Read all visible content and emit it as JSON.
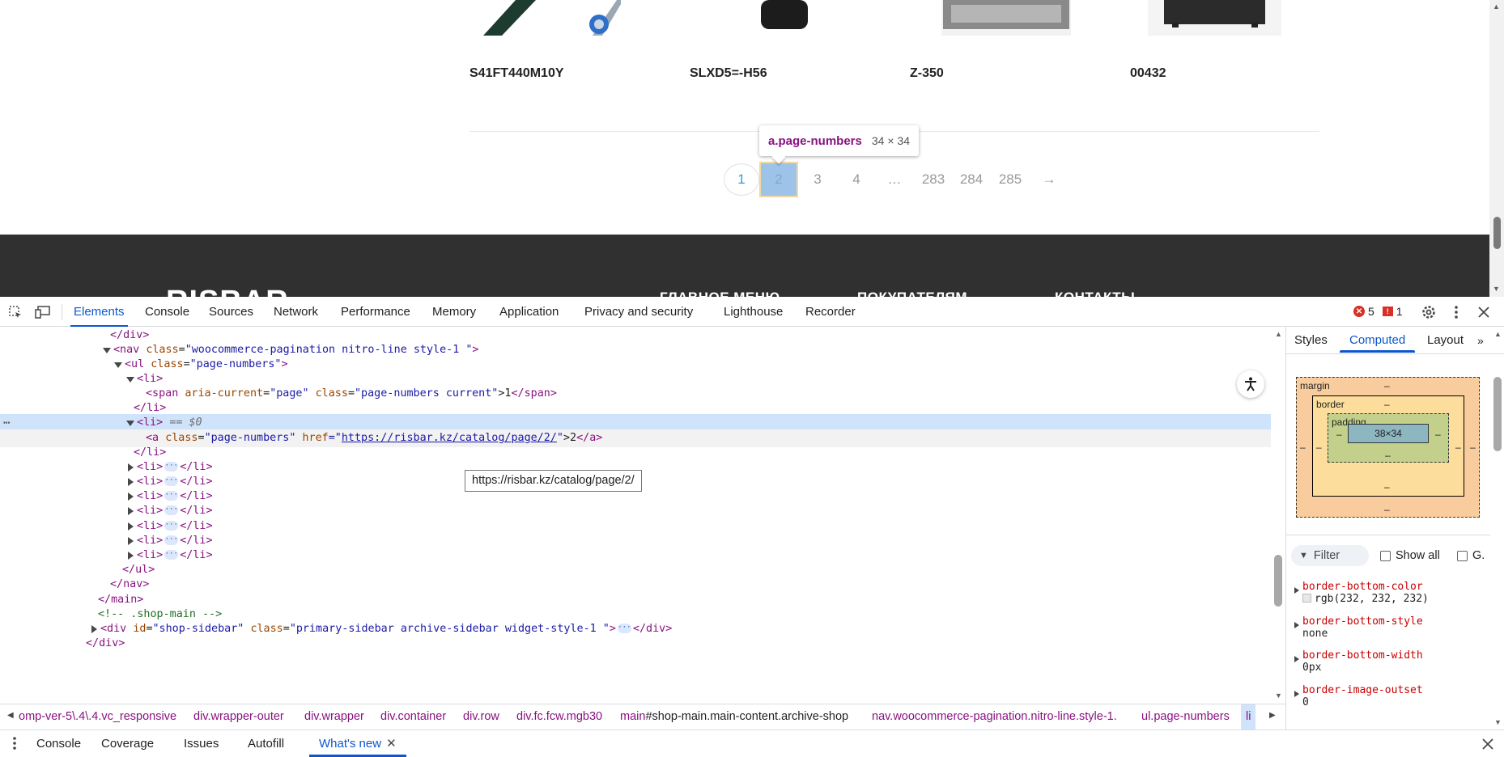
{
  "page": {
    "products": [
      {
        "sku": "S41FT440M10Y"
      },
      {
        "sku": "SLXD5=-H56"
      },
      {
        "sku": "Z-350"
      },
      {
        "sku": "00432"
      }
    ],
    "pagination": [
      "1",
      "2",
      "3",
      "4",
      "…",
      "283",
      "284",
      "285",
      "→"
    ],
    "tooltip": {
      "selector": "a.page-numbers",
      "size": "34 × 34"
    },
    "footer": {
      "logo": "RISBAR",
      "headings": [
        "ГЛАВНОЕ МЕНЮ",
        "ПОКУПАТЕЛЯМ",
        "КОНТАКТЫ"
      ]
    }
  },
  "devtools": {
    "tabs": [
      "Elements",
      "Console",
      "Sources",
      "Network",
      "Performance",
      "Memory",
      "Application",
      "Privacy and security",
      "Lighthouse",
      "Recorder"
    ],
    "active_tab": "Elements",
    "error_count": "5",
    "issue_count": "1",
    "dom": {
      "l0": {
        "close": "</div>"
      },
      "l1": {
        "open": "<nav",
        "attr": "class",
        "val": "\"woocommerce-pagination nitro-line style-1 \"",
        "end": ">"
      },
      "l2": {
        "open": "<ul",
        "attr": "class",
        "val": "\"page-numbers\"",
        "end": ">"
      },
      "l3": {
        "tag": "<li>"
      },
      "l4": {
        "open": "<span",
        "attr1": "aria-current",
        "val1": "\"page\"",
        "attr2": "class",
        "val2": "\"page-numbers current\"",
        "text": ">1",
        "close": "</span>"
      },
      "l5": {
        "close": "</li>"
      },
      "l6": {
        "tag": "<li>",
        "marker": "== $0"
      },
      "l7": {
        "open": "<a",
        "attr1": "class",
        "val1": "\"page-numbers\"",
        "attr2": "href",
        "q1": "=\"",
        "link": "https://risbar.kz/catalog/page/2/",
        "q2": "\"",
        "text": ">2",
        "close": "</a>"
      },
      "l8": {
        "close": "</li>"
      },
      "collapsed_li": {
        "open": "<li>",
        "close": "</li>"
      },
      "l16": {
        "close": "</ul>"
      },
      "l17": {
        "close": "</nav>"
      },
      "l18": {
        "close": "</main>"
      },
      "l19": {
        "comment": "<!-- .shop-main -->"
      },
      "l20": {
        "open": "<div",
        "attr1": "id",
        "val1": "\"shop-sidebar\"",
        "attr2": "class",
        "val2": "\"primary-sidebar archive-sidebar widget-style-1 \"",
        "end": ">",
        "close": "</div>"
      },
      "l21": {
        "close": "</div>"
      }
    },
    "link_tooltip": "https://risbar.kz/catalog/page/2/",
    "breadcrumbs": [
      {
        "tag": "omp-ver-5\\.4\\.4.vc_responsive",
        "rest": ""
      },
      {
        "tag": "div.wrapper-outer",
        "rest": ""
      },
      {
        "tag": "div.wrapper",
        "rest": ""
      },
      {
        "tag": "div.container",
        "rest": ""
      },
      {
        "tag": "div.row",
        "rest": ""
      },
      {
        "tag": "div.fc.fcw.mgb30",
        "rest": ""
      },
      {
        "tag": "main",
        "rest": "#shop-main.main-content.archive-shop"
      },
      {
        "tag": "nav.woocommerce-pagination.nitro-line.style-1.",
        "rest": ""
      },
      {
        "tag": "ul.page-numbers",
        "rest": ""
      },
      {
        "tag": "li",
        "rest": ""
      }
    ],
    "sidebar": {
      "tabs": [
        "Styles",
        "Computed",
        "Layout"
      ],
      "active_tab": "Computed",
      "box_model": {
        "margin": "margin",
        "border": "border",
        "padding": "padding",
        "content": "38×34",
        "dash": "–"
      },
      "filter_placeholder": "Filter",
      "show_all": "Show all",
      "group": "G.",
      "properties": [
        {
          "name": "border-bottom-color",
          "value": "rgb(232, 232, 232)",
          "swatch": "#e8e8e8"
        },
        {
          "name": "border-bottom-style",
          "value": "none"
        },
        {
          "name": "border-bottom-width",
          "value": "0px"
        },
        {
          "name": "border-image-outset",
          "value": "0"
        }
      ]
    },
    "drawer_tabs": [
      "Console",
      "Coverage",
      "Issues",
      "Autofill",
      "What's new"
    ],
    "active_drawer_tab": "What's new"
  }
}
